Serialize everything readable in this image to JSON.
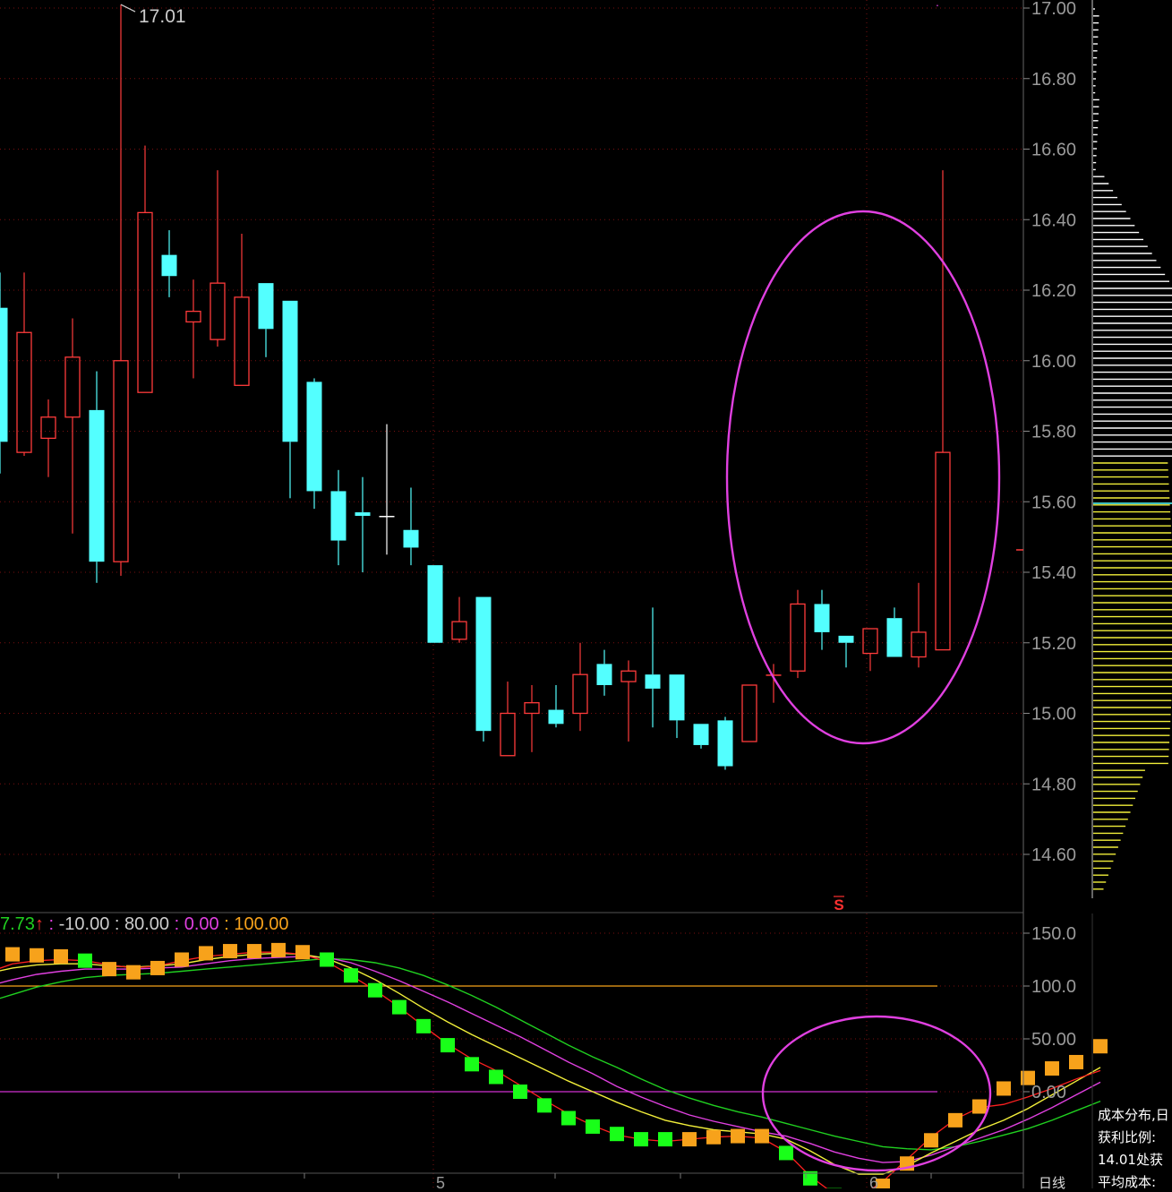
{
  "colors": {
    "background": "#000000",
    "up": "#ff3b3b",
    "down": "#53ffff",
    "doji": "#ffffff",
    "grid": "#7a1010",
    "axis_text": "#9a9a9a",
    "ellipse": "#e040e0",
    "hist_white": "#ffffff",
    "hist_yellow": "#f2ef3a",
    "avg_cost": "#53ffff",
    "ind_red": "#ff2020",
    "ind_yellow": "#f2ef3a",
    "ind_magenta": "#e040e0",
    "ind_green": "#20d020",
    "ind_orange_bar": "#f7a21b",
    "ind_green_bar": "#19ff19",
    "hline_orange": "#f7a21b",
    "hline_magenta": "#d030d0"
  },
  "chart_data": [
    {
      "type": "candlestick",
      "ylim": [
        14.46,
        17.02
      ],
      "y_ticks": [
        "17.00",
        "16.80",
        "16.60",
        "16.40",
        "16.20",
        "16.00",
        "15.80",
        "15.60",
        "15.40",
        "15.20",
        "15.00",
        "14.80",
        "14.60"
      ],
      "high_marker": "17.01",
      "x_labels": [
        "5",
        "6"
      ],
      "bottom_marker": "S",
      "candles": [
        {
          "o": 16.15,
          "h": 16.25,
          "l": 15.68,
          "c": 15.77
        },
        {
          "o": 15.74,
          "h": 16.25,
          "l": 15.73,
          "c": 16.08
        },
        {
          "o": 15.78,
          "h": 15.89,
          "l": 15.67,
          "c": 15.84
        },
        {
          "o": 15.84,
          "h": 16.12,
          "l": 15.51,
          "c": 16.01
        },
        {
          "o": 15.86,
          "h": 15.97,
          "l": 15.37,
          "c": 15.43
        },
        {
          "o": 15.43,
          "h": 17.01,
          "l": 15.39,
          "c": 16.0
        },
        {
          "o": 15.91,
          "h": 16.61,
          "l": 15.91,
          "c": 16.42
        },
        {
          "o": 16.3,
          "h": 16.37,
          "l": 16.18,
          "c": 16.24
        },
        {
          "o": 16.11,
          "h": 16.23,
          "l": 15.95,
          "c": 16.14
        },
        {
          "o": 16.06,
          "h": 16.54,
          "l": 16.04,
          "c": 16.22
        },
        {
          "o": 15.93,
          "h": 16.36,
          "l": 15.93,
          "c": 16.18
        },
        {
          "o": 16.22,
          "h": 16.22,
          "l": 16.01,
          "c": 16.09
        },
        {
          "o": 16.17,
          "h": 16.17,
          "l": 15.61,
          "c": 15.77
        },
        {
          "o": 15.94,
          "h": 15.95,
          "l": 15.58,
          "c": 15.63
        },
        {
          "o": 15.63,
          "h": 15.69,
          "l": 15.42,
          "c": 15.49
        },
        {
          "o": 15.57,
          "h": 15.67,
          "l": 15.4,
          "c": 15.56
        },
        {
          "o": 15.56,
          "h": 15.82,
          "l": 15.45,
          "c": 15.56
        },
        {
          "o": 15.52,
          "h": 15.64,
          "l": 15.42,
          "c": 15.47
        },
        {
          "o": 15.42,
          "h": 15.42,
          "l": 15.2,
          "c": 15.2
        },
        {
          "o": 15.21,
          "h": 15.33,
          "l": 15.2,
          "c": 15.26
        },
        {
          "o": 15.33,
          "h": 15.33,
          "l": 14.92,
          "c": 14.95
        },
        {
          "o": 14.88,
          "h": 15.09,
          "l": 14.88,
          "c": 15.0
        },
        {
          "o": 15.0,
          "h": 15.08,
          "l": 14.89,
          "c": 15.03
        },
        {
          "o": 15.01,
          "h": 15.08,
          "l": 14.96,
          "c": 14.97
        },
        {
          "o": 15.0,
          "h": 15.2,
          "l": 14.95,
          "c": 15.11
        },
        {
          "o": 15.14,
          "h": 15.18,
          "l": 15.05,
          "c": 15.08
        },
        {
          "o": 15.09,
          "h": 15.15,
          "l": 14.92,
          "c": 15.12
        },
        {
          "o": 15.11,
          "h": 15.3,
          "l": 14.96,
          "c": 15.07
        },
        {
          "o": 15.11,
          "h": 15.11,
          "l": 14.93,
          "c": 14.98
        },
        {
          "o": 14.97,
          "h": 14.97,
          "l": 14.9,
          "c": 14.91
        },
        {
          "o": 14.98,
          "h": 14.99,
          "l": 14.84,
          "c": 14.85
        },
        {
          "o": 14.92,
          "h": 15.08,
          "l": 14.92,
          "c": 15.08
        },
        {
          "o": 15.11,
          "h": 15.14,
          "l": 15.03,
          "c": 15.11
        },
        {
          "o": 15.12,
          "h": 15.35,
          "l": 15.1,
          "c": 15.31
        },
        {
          "o": 15.31,
          "h": 15.35,
          "l": 15.18,
          "c": 15.23
        },
        {
          "o": 15.22,
          "h": 15.22,
          "l": 15.13,
          "c": 15.2
        },
        {
          "o": 15.17,
          "h": 15.24,
          "l": 15.12,
          "c": 15.24
        },
        {
          "o": 15.27,
          "h": 15.3,
          "l": 15.16,
          "c": 15.16
        },
        {
          "o": 15.16,
          "h": 15.37,
          "l": 15.13,
          "c": 15.23
        },
        {
          "o": 15.18,
          "h": 16.54,
          "l": 15.18,
          "c": 15.74
        }
      ]
    },
    {
      "type": "line",
      "header": {
        "parts": [
          {
            "text": "7.73",
            "color": "#20d020"
          },
          {
            "text": "↑",
            "color": "#ff3030"
          },
          {
            "text": " : ",
            "color": "#e040e0"
          },
          {
            "text": "-10.00",
            "color": "#cccccc"
          },
          {
            "text": " : ",
            "color": "#cccccc"
          },
          {
            "text": "80.00",
            "color": "#cccccc"
          },
          {
            "text": " : ",
            "color": "#e040e0"
          },
          {
            "text": "0.00",
            "color": "#e040e0"
          },
          {
            "text": " : ",
            "color": "#f7a21b"
          },
          {
            "text": "100.00",
            "color": "#f7a21b"
          }
        ]
      },
      "ylim": [
        -155,
        165
      ],
      "y_ticks": [
        "150.0",
        "100.0",
        "50.00",
        "0.00"
      ],
      "hlines": [
        100,
        0
      ],
      "main": [
        113,
        121,
        124,
        125,
        124,
        120,
        117,
        119,
        124,
        128,
        130,
        132,
        132,
        130,
        123,
        110,
        96,
        80,
        62,
        45,
        31,
        20,
        6,
        -8,
        -21,
        -32,
        -41,
        -45,
        -47,
        -45,
        -43,
        -42,
        -44,
        -57,
        -80,
        -97,
        -100,
        -85,
        -64,
        -43,
        -26,
        -15,
        -12,
        -5,
        3,
        12,
        20
      ],
      "yellow": [
        112,
        117,
        120,
        121,
        121,
        119,
        118,
        119,
        121,
        125,
        128,
        130,
        131,
        130,
        126,
        117,
        106,
        93,
        79,
        66,
        54,
        43,
        32,
        21,
        10,
        0,
        -10,
        -19,
        -27,
        -32,
        -36,
        -38,
        -40,
        -45,
        -56,
        -69,
        -78,
        -78,
        -70,
        -58,
        -47,
        -36,
        -27,
        -16,
        -3,
        10,
        23
      ],
      "magenta": [
        100,
        106,
        111,
        114,
        116,
        116,
        116,
        117,
        118,
        121,
        124,
        126,
        127,
        128,
        127,
        122,
        114,
        105,
        95,
        85,
        74,
        63,
        52,
        40,
        28,
        17,
        5,
        -5,
        -14,
        -22,
        -28,
        -33,
        -38,
        -42,
        -49,
        -57,
        -63,
        -67,
        -66,
        -60,
        -52,
        -44,
        -36,
        -26,
        -15,
        -3,
        9
      ],
      "green": [
        85,
        92,
        99,
        104,
        108,
        110,
        111,
        112,
        114,
        116,
        118,
        120,
        122,
        124,
        126,
        125,
        122,
        117,
        110,
        101,
        91,
        80,
        68,
        56,
        44,
        33,
        23,
        12,
        2,
        -6,
        -13,
        -19,
        -24,
        -30,
        -36,
        -42,
        -47,
        -52,
        -54,
        -55,
        -52,
        -47,
        -41,
        -35,
        -27,
        -18,
        -9
      ],
      "bars": [
        125,
        130,
        129,
        128,
        124,
        116,
        113,
        117,
        125,
        131,
        133,
        133,
        134,
        132,
        125,
        110,
        96,
        80,
        62,
        44,
        26,
        14,
        0,
        -13,
        -25,
        -33,
        -40,
        -45,
        -45,
        -45,
        -43,
        -42,
        -42,
        -58,
        -82,
        -98,
        -100,
        -89,
        -68,
        -46,
        -27,
        -14,
        3,
        13,
        22,
        28,
        43
      ],
      "bar_up": [
        true,
        true,
        true,
        true,
        false,
        true,
        true,
        true,
        true,
        true,
        true,
        true,
        true,
        true,
        false,
        false,
        false,
        false,
        false,
        false,
        false,
        false,
        false,
        false,
        false,
        false,
        false,
        false,
        false,
        true,
        true,
        true,
        true,
        false,
        false,
        false,
        false,
        true,
        true,
        true,
        true,
        true,
        true,
        true,
        true,
        true,
        true
      ],
      "x_labels": [
        "5",
        "6"
      ]
    }
  ],
  "cost_distribution": {
    "title": "成本分布,日",
    "profit_ratio_label": "获利比例:",
    "profit_line": "14.01处获",
    "avg_cost_label": "平均成本:"
  },
  "period_label": "日线"
}
